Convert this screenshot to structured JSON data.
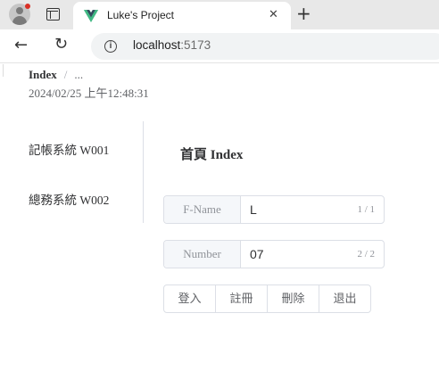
{
  "browser": {
    "tab_title": "Luke's Project",
    "url_host": "localhost",
    "url_port": ":5173"
  },
  "page": {
    "breadcrumb": {
      "current": "Index",
      "separator": "/",
      "more": "..."
    },
    "timestamp": "2024/02/25 上午12:48:31",
    "menu": [
      {
        "label": "記帳系統 W001"
      },
      {
        "label": "總務系統 W002"
      }
    ],
    "title": "首頁 Index",
    "fields": {
      "fname": {
        "label": "F-Name",
        "value": "L",
        "count": "1 / 1"
      },
      "number": {
        "label": "Number",
        "value": "07",
        "count": "2 / 2"
      }
    },
    "buttons": {
      "login": "登入",
      "register": "註冊",
      "delete": "刪除",
      "logout": "退出"
    }
  },
  "colors": {
    "vue_green": "#41b883",
    "vue_dark": "#35495e",
    "notification_dot": "#d93025"
  }
}
